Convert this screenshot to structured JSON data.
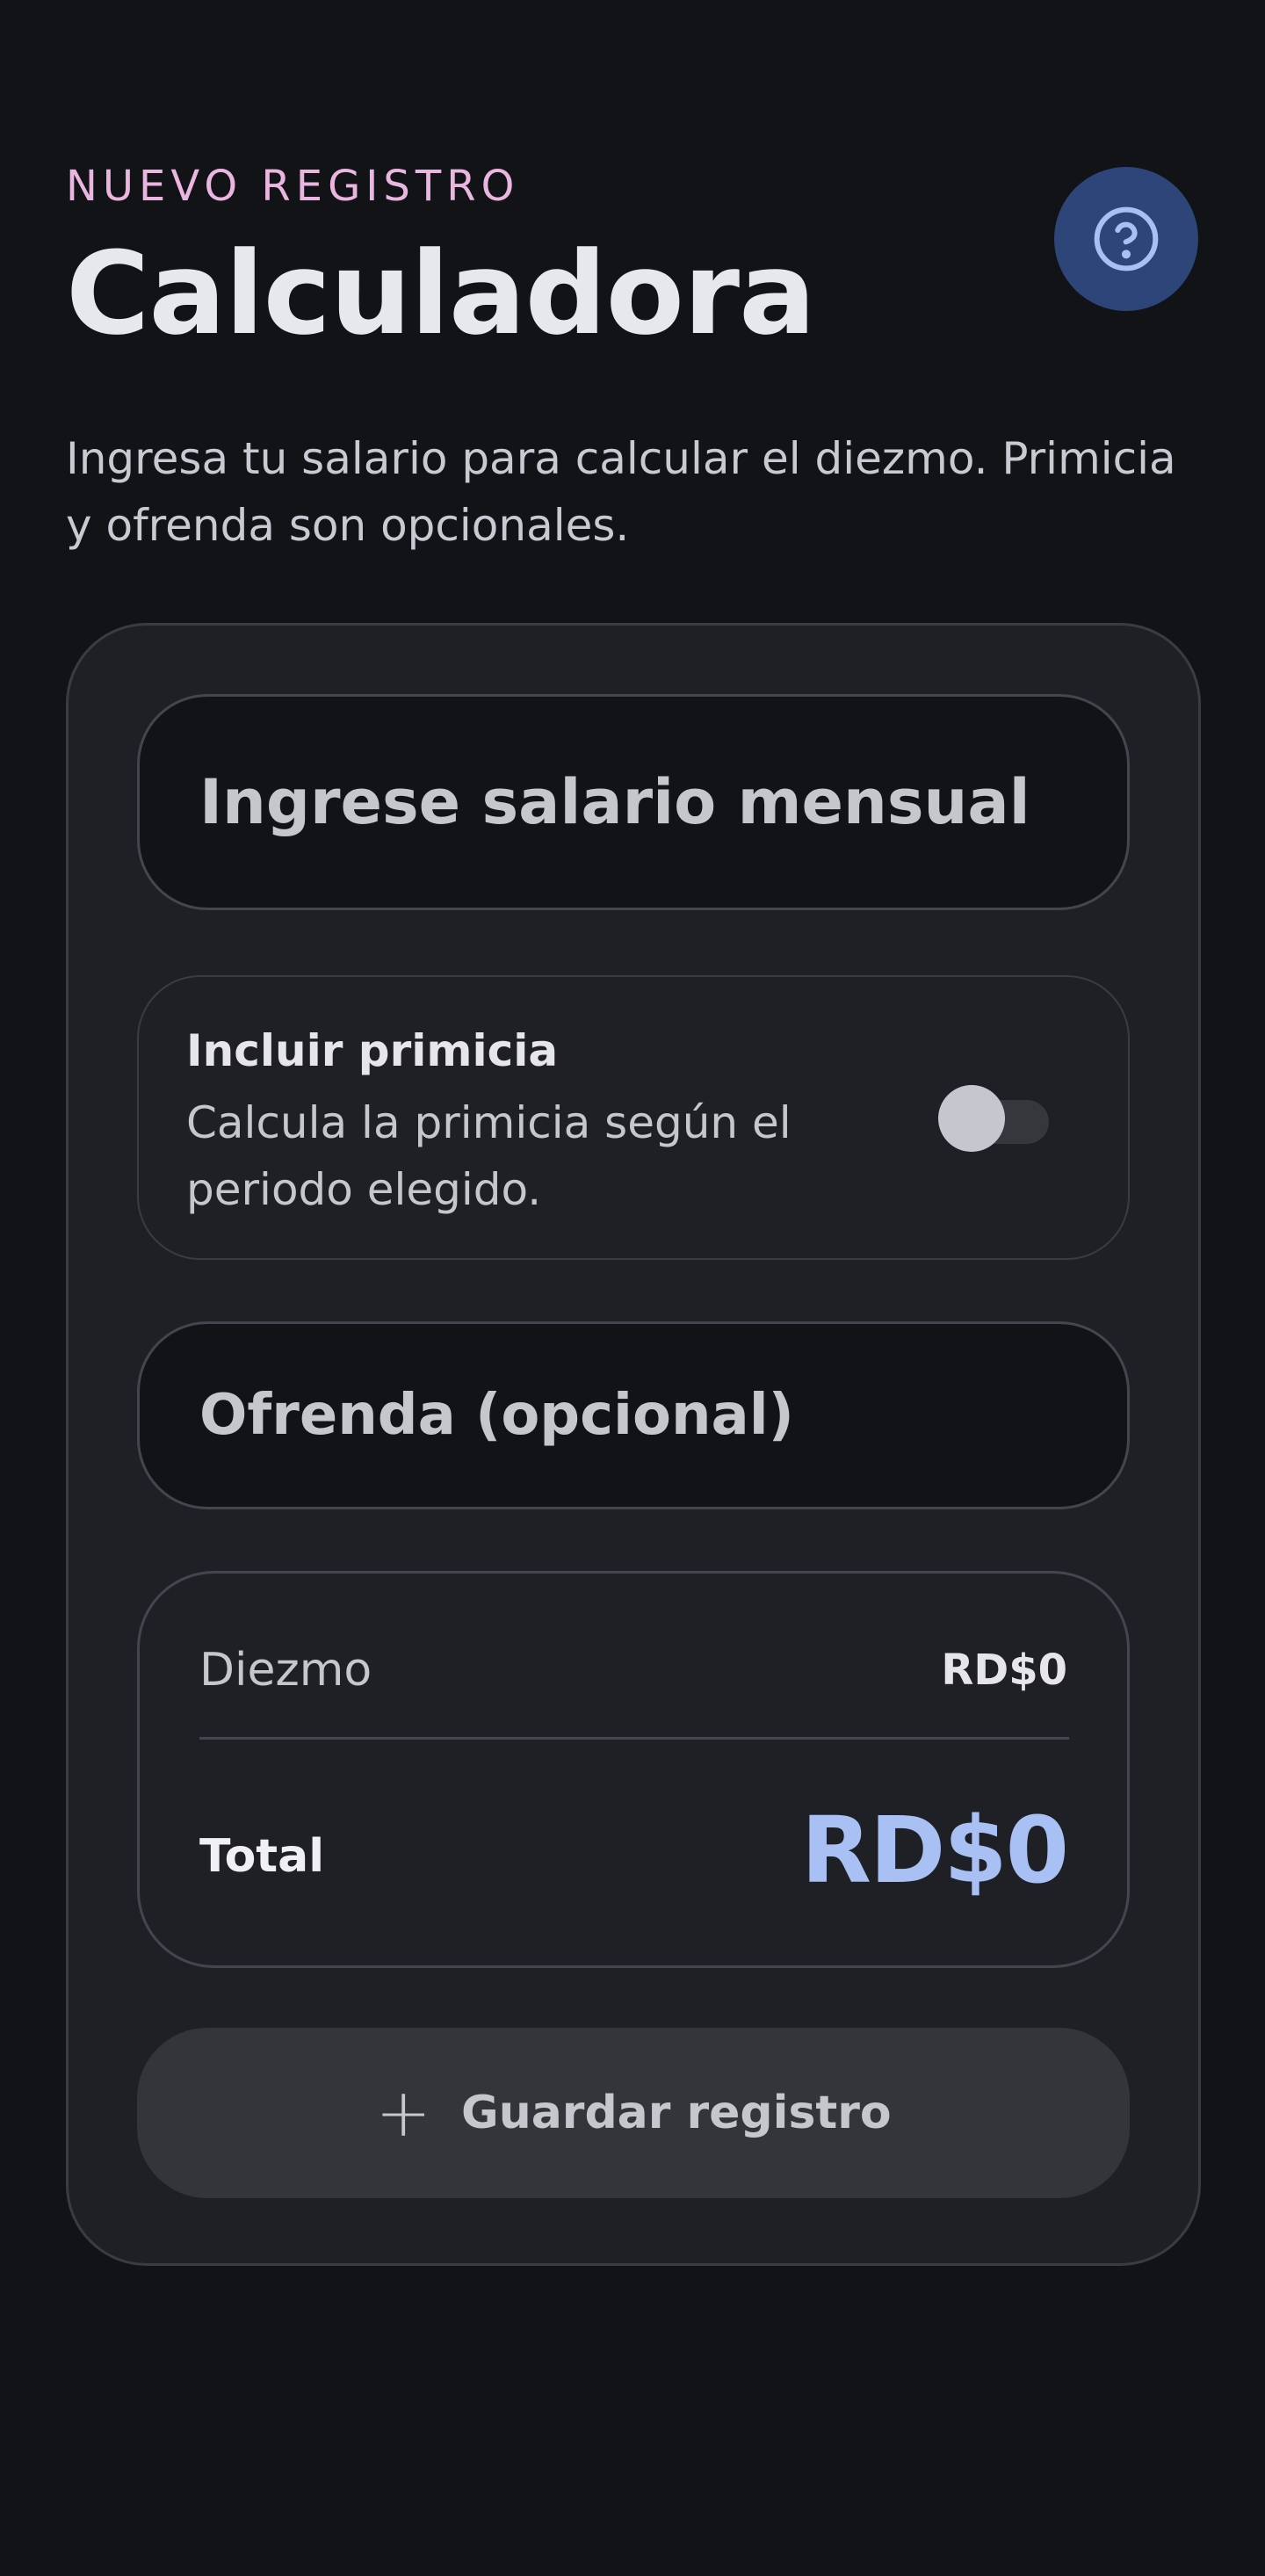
{
  "header": {
    "eyebrow": "NUEVO REGISTRO",
    "title": "Calculadora",
    "help_icon": "help-circle-icon"
  },
  "description": "Ingresa tu salario para calcular el diezmo. Primicia y ofrenda son opcionales.",
  "form": {
    "salary": {
      "placeholder": "Ingrese salario mensual",
      "value": ""
    },
    "primicia": {
      "title": "Incluir primicia",
      "description": "Calcula la primicia según el periodo elegido.",
      "enabled": false
    },
    "offering": {
      "placeholder": "Ofrenda (opcional)",
      "value": ""
    }
  },
  "summary": {
    "tithe_label": "Diezmo",
    "tithe_value": "RD$0",
    "total_label": "Total",
    "total_value": "RD$0"
  },
  "actions": {
    "save_label": "Guardar registro",
    "save_icon": "plus-icon"
  },
  "colors": {
    "background": "#121317",
    "accent_pink": "#eab6e0",
    "accent_blue": "#a9c0f4",
    "help_button": "#2e4579"
  }
}
